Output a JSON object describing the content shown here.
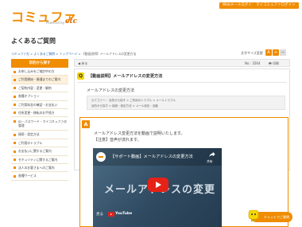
{
  "header": {
    "logo_text": "コミュファ",
    "logo_sub": "Powered by",
    "logo_brand": "ctc",
    "buttons": [
      "Webメールログイン",
      "マイコミュファログイン"
    ]
  },
  "page": {
    "title": "よくあるご質問",
    "breadcrumb": {
      "items": [
        "コミュファ光",
        "よくあるご質問",
        "トップページ"
      ],
      "current": "【動画説明】メールアドレスの変更方法"
    },
    "font_size": {
      "label": "文字サイズ変更",
      "buttons": [
        "A",
        "+",
        "−"
      ]
    }
  },
  "sidebar": {
    "header": "目的から探す",
    "items": [
      {
        "label": "お申し込みをご検討中の方"
      },
      {
        "label": "ご利用開始・開通までのご案内",
        "active": true
      },
      {
        "label": "ご契約内容・変更・解約"
      },
      {
        "label": "各種オプション"
      },
      {
        "label": "ご利用料金の確認・お支払い"
      },
      {
        "label": "住所変更・移転のお手続き"
      },
      {
        "label": "ID・パスワード・マイコミュファの管理",
        "two_line": true
      },
      {
        "label": "接続・設定方法"
      },
      {
        "label": "ご利用のトラブル"
      },
      {
        "label": "お支払いに関するご案内"
      },
      {
        "label": "セキュリティに関するご案内"
      },
      {
        "label": "法人のお客さまへのご案内"
      },
      {
        "label": "各種サービス"
      }
    ]
  },
  "main": {
    "back_label": "戻る",
    "no_label": "No : 3564",
    "print_label": "印刷",
    "question": {
      "badge": "Q",
      "title": "【動画説明】メールアドレスの変更方法",
      "subtitle": "メールアドレスの変更方法",
      "category_line1": "カテゴリー： 目的から探す > ご利用のトラブル > メールトラブル",
      "category_line2": "目的から探す > 接続・設定方法 > メール設定・自動"
    },
    "answer": {
      "badge": "A",
      "text1": "メールアドレス変更方法を動画で説明いたします。",
      "text2": "【注意】音声が流れます。"
    },
    "video": {
      "title": "【サポート動画】メールアドレスの変更方法",
      "share_label": "共有",
      "big_text": "メールアドレスの変更",
      "watch_label": "見る",
      "yt_label": "YouTube"
    }
  },
  "chat": {
    "label": "チャットでご質問"
  }
}
